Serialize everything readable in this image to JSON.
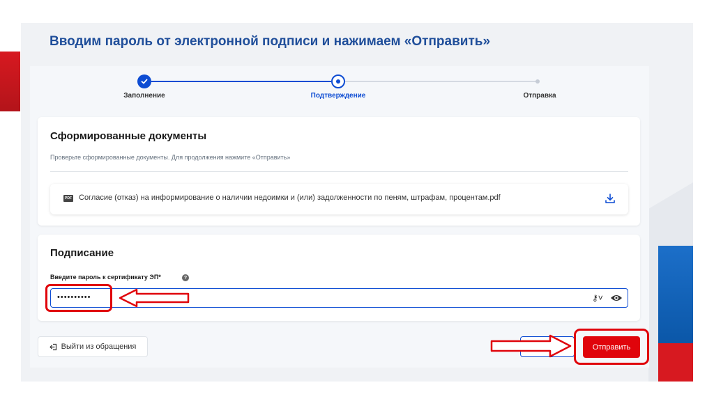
{
  "slide": {
    "heading": "Вводим пароль от электронной подписи и нажимаем «Отправить»"
  },
  "stepper": {
    "steps": [
      {
        "label": "Заполнение",
        "state": "done"
      },
      {
        "label": "Подтверждение",
        "state": "current"
      },
      {
        "label": "Отправка",
        "state": "pending"
      }
    ]
  },
  "documents": {
    "title": "Сформированные документы",
    "hint": "Проверьте сформированные документы. Для продолжения нажмите «Отправить»",
    "file_badge": "PDF",
    "file_name": "Согласие (отказ) на информирование о наличии недоимки и (или) задолженности по пеням, штрафам, процентам.pdf"
  },
  "signing": {
    "title": "Подписание",
    "password_label": "Введите пароль к сертификату ЭП*",
    "password_value": "••••••••••"
  },
  "actions": {
    "exit_label": "Выйти из обращения",
    "send_label": "Отправить"
  },
  "colors": {
    "accent": "#0d4cd3",
    "heading": "#1f4e9a",
    "send": "#e0040b",
    "annotation": "#e0040b"
  },
  "icons": [
    "check-icon",
    "pdf-icon",
    "download-icon",
    "help-icon",
    "key-icon",
    "eye-icon",
    "exit-icon",
    "arrow-annotation"
  ]
}
